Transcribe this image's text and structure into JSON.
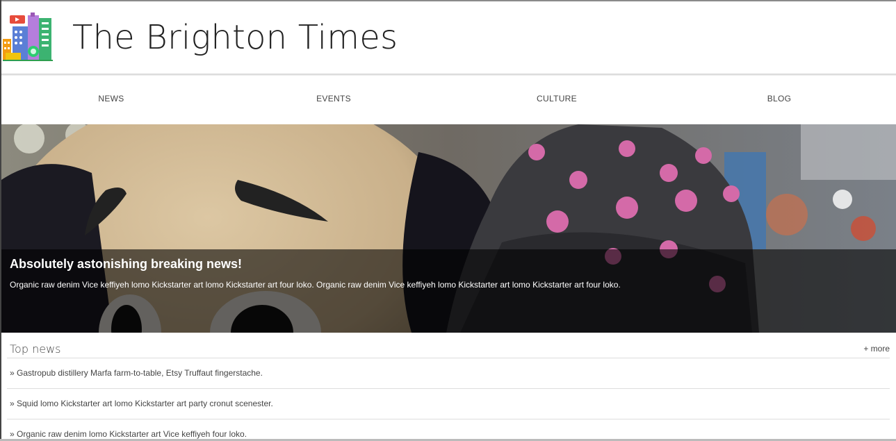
{
  "site": {
    "title": "The Brighton Times",
    "logo_icon": "city-buildings-icon"
  },
  "nav": {
    "items": [
      {
        "label": "NEWS"
      },
      {
        "label": "EVENTS"
      },
      {
        "label": "CULTURE"
      },
      {
        "label": "BLOG"
      }
    ]
  },
  "hero": {
    "headline": "Absolutely astonishing breaking news!",
    "text": "Organic raw denim Vice keffiyeh lomo Kickstarter art lomo Kickstarter art four loko. Organic raw denim Vice keffiyeh lomo Kickstarter art lomo Kickstarter art four loko."
  },
  "top_news": {
    "title": "Top news",
    "more_label": "+ more",
    "items": [
      {
        "text": "» Gastropub distillery Marfa farm-to-table, Etsy Truffaut fingerstache."
      },
      {
        "text": "» Squid lomo Kickstarter art lomo Kickstarter art party cronut scenester."
      },
      {
        "text": "» Organic raw denim lomo Kickstarter art Vice keffiyeh four loko."
      }
    ]
  }
}
